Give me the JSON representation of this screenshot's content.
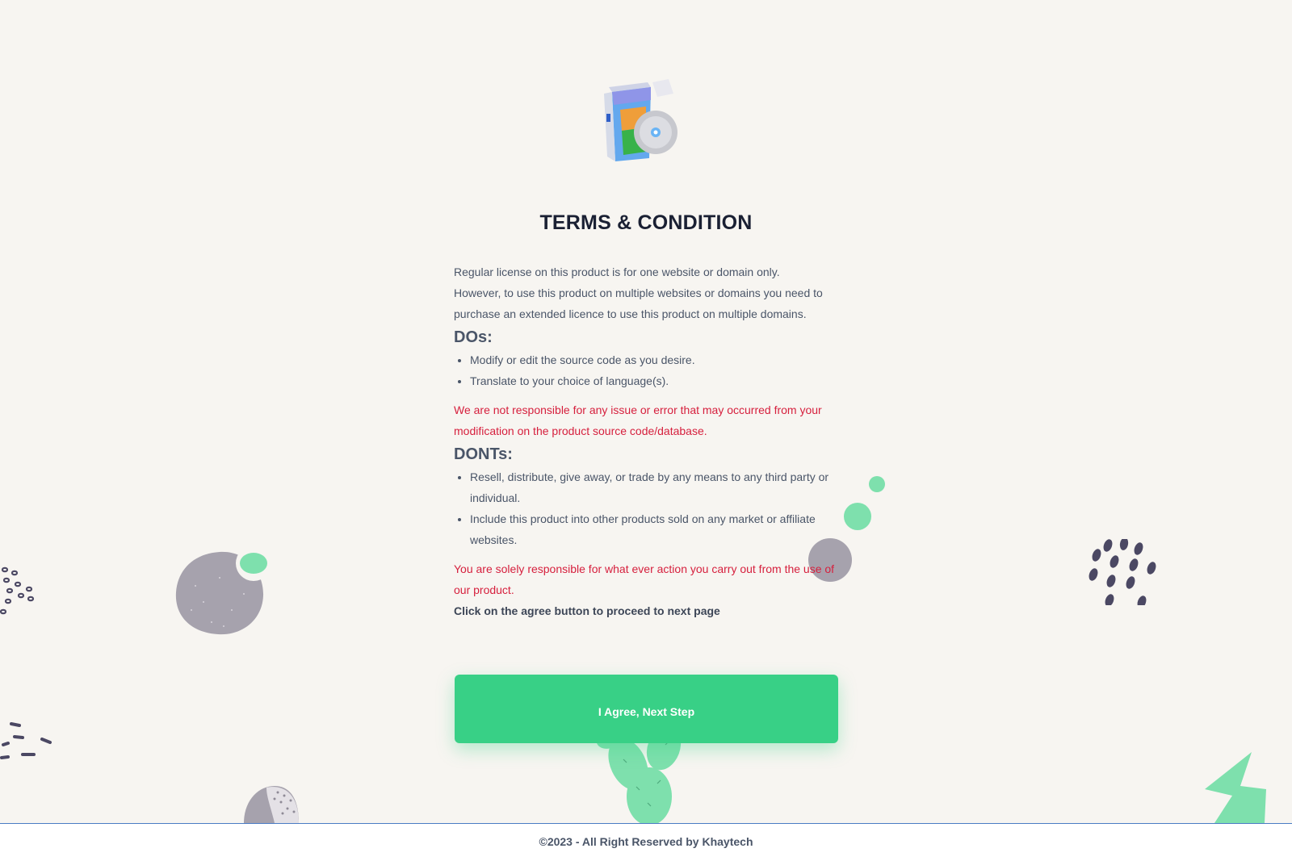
{
  "page": {
    "title": "TERMS & CONDITION",
    "intro": [
      "Regular license on this product is for one website or domain only.",
      "However, to use this product on multiple websites or domains you need to purchase an extended licence to use this product on multiple domains."
    ],
    "dos": {
      "heading": "DOs:",
      "items": [
        "Modify or edit the source code as you desire.",
        "Translate to your choice of language(s)."
      ],
      "warning": "We are not responsible for any issue or error that may occurred from your modification on the product source code/database."
    },
    "donts": {
      "heading": "DONTs:",
      "items": [
        "Resell, distribute, give away, or trade by any means to any third party or individual.",
        "Include this product into other products sold on any market or affiliate websites."
      ],
      "warning": "You are solely responsible for what ever action you carry out from the use of our product."
    },
    "instruction": "Click on the agree button to proceed to next page",
    "agree_button": "I Agree, Next Step"
  },
  "footer": {
    "copyright": "©2023 - All Right Reserved by Khaytech"
  },
  "icons": {
    "product": "software-box-icon"
  },
  "colors": {
    "background": "#f7f5f1",
    "accent_green": "#38d086",
    "warning_red": "#d61f3d",
    "title": "#1a2033",
    "text": "#4a5568"
  }
}
